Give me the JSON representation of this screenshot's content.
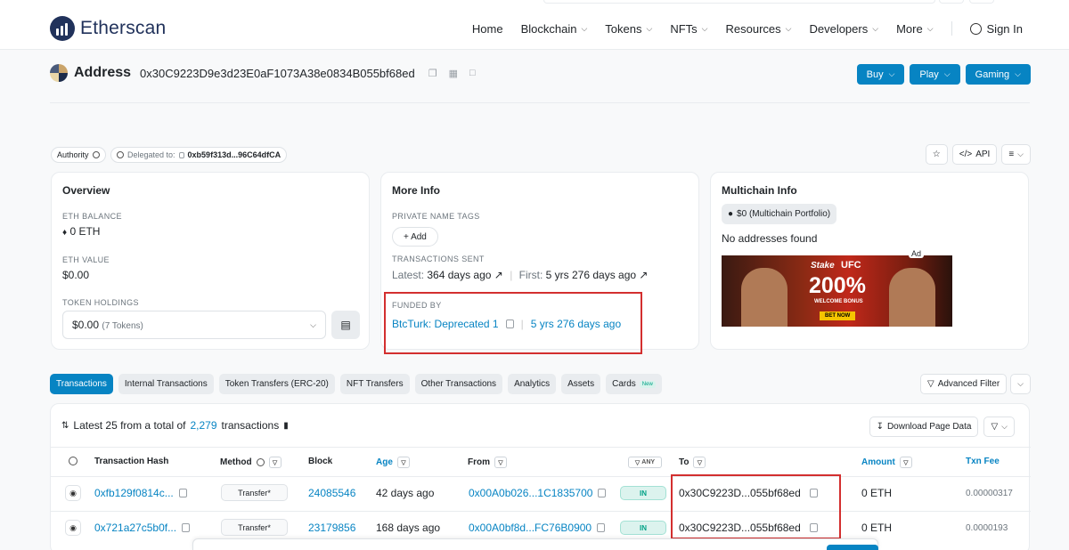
{
  "colors": {
    "accent": "#0784c3",
    "highlight": "#d32f2f",
    "in_badge": "#00a186"
  },
  "header": {
    "logo_text": "Etherscan",
    "nav": [
      {
        "label": "Home",
        "dropdown": false
      },
      {
        "label": "Blockchain",
        "dropdown": true
      },
      {
        "label": "Tokens",
        "dropdown": true
      },
      {
        "label": "NFTs",
        "dropdown": true
      },
      {
        "label": "Resources",
        "dropdown": true
      },
      {
        "label": "Developers",
        "dropdown": true
      },
      {
        "label": "More",
        "dropdown": true
      }
    ],
    "sign_in": "Sign In"
  },
  "address": {
    "title": "Address",
    "hash": "0x30C9223D9e3d23E0aF1073A38e0834B055bf68ed",
    "buttons": {
      "buy": "Buy",
      "play": "Play",
      "gaming": "Gaming"
    }
  },
  "pills": {
    "authority": "Authority",
    "delegated_label": "Delegated to:",
    "delegated_addr": "0xb59f313d...96C64dfCA"
  },
  "tools": {
    "api": "API"
  },
  "overview": {
    "title": "Overview",
    "eth_balance_label": "ETH BALANCE",
    "eth_balance": "0 ETH",
    "eth_value_label": "ETH VALUE",
    "eth_value": "$0.00",
    "token_holdings_label": "TOKEN HOLDINGS",
    "token_holdings": "$0.00",
    "token_count": "(7 Tokens)"
  },
  "more_info": {
    "title": "More Info",
    "private_tags_label": "PRIVATE NAME TAGS",
    "add_label": "+ Add",
    "tx_sent_label": "TRANSACTIONS SENT",
    "latest_label": "Latest:",
    "latest_value": "364 days ago",
    "first_label": "First:",
    "first_value": "5 yrs 276 days ago",
    "funded_by_label": "FUNDED BY",
    "funded_by": "BtcTurk: Deprecated 1",
    "funded_age": "5 yrs 276 days ago"
  },
  "multichain": {
    "title": "Multichain Info",
    "portfolio": "$0 (Multichain Portfolio)",
    "no_addresses": "No addresses found",
    "ad_label": "Ad",
    "banner": {
      "brand": "Stake",
      "ufc": "UFC",
      "headline": "200%",
      "sub": "WELCOME BONUS",
      "cta": "BET NOW"
    }
  },
  "tabs": [
    {
      "label": "Transactions",
      "active": true
    },
    {
      "label": "Internal Transactions"
    },
    {
      "label": "Token Transfers (ERC-20)"
    },
    {
      "label": "NFT Transfers"
    },
    {
      "label": "Other Transactions"
    },
    {
      "label": "Analytics"
    },
    {
      "label": "Assets"
    },
    {
      "label": "Cards",
      "badge": "New"
    }
  ],
  "advanced_filter": "Advanced Filter",
  "table": {
    "summary_prefix": "Latest 25 from a total of",
    "summary_count": "2,279",
    "summary_suffix": "transactions",
    "download": "Download Page Data",
    "headers": {
      "hash": "Transaction Hash",
      "method": "Method",
      "block": "Block",
      "age": "Age",
      "from": "From",
      "any": "ANY",
      "to": "To",
      "amount": "Amount",
      "fee": "Txn Fee"
    },
    "rows": [
      {
        "hash": "0xfb129f0814c...",
        "method": "Transfer*",
        "block": "24085546",
        "age": "42 days ago",
        "from": "0x00A0b026...1C1835700",
        "direction": "IN",
        "to": "0x30C9223D...055bf68ed",
        "amount": "0 ETH",
        "fee": "0.00000317"
      },
      {
        "hash": "0x721a27c5b0f...",
        "method": "Transfer*",
        "block": "23179856",
        "age": "168 days ago",
        "from": "0x00A0bf8d...FC76B0900",
        "direction": "IN",
        "to": "0x30C9223D...055bf68ed",
        "amount": "0 ETH",
        "fee": "0.0000193"
      }
    ]
  }
}
